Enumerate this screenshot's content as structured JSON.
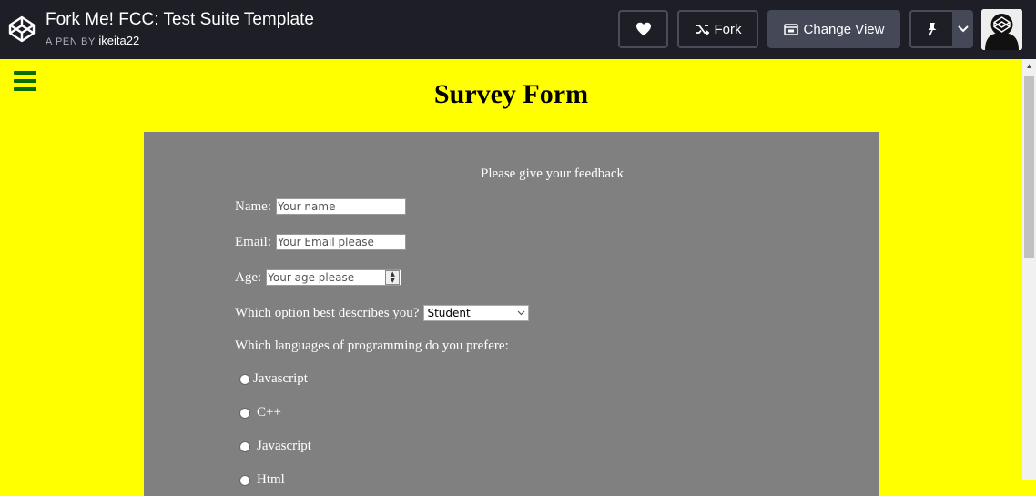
{
  "header": {
    "pen_title": "Fork Me! FCC: Test Suite Template",
    "pen_by_label": "A PEN BY",
    "author": "ikeita22",
    "buttons": {
      "like_icon": "heart-icon",
      "fork_label": "Fork",
      "change_view_label": "Change View",
      "pin_icon": "pin-icon",
      "pin_dropdown_icon": "chevron-down-icon"
    }
  },
  "form": {
    "title": "Survey Form",
    "subtitle": "Please give your feedback",
    "name": {
      "label": "Name:",
      "placeholder": "Your name"
    },
    "email": {
      "label": "Email:",
      "placeholder": "Your Email please"
    },
    "age": {
      "label": "Age:",
      "placeholder": "Your age please"
    },
    "role": {
      "label": "Which option best describes you?",
      "selected": "Student"
    },
    "languages_question": "Which languages of programming do you prefere:",
    "languages": [
      {
        "label": "Javascript"
      },
      {
        "label": "C++"
      },
      {
        "label": "Javascript"
      },
      {
        "label": "Html"
      }
    ]
  },
  "colors": {
    "page_background": "#ffff00",
    "form_background": "#808080",
    "header_background": "#1e1f26",
    "hamburger": "#0a6b00"
  }
}
